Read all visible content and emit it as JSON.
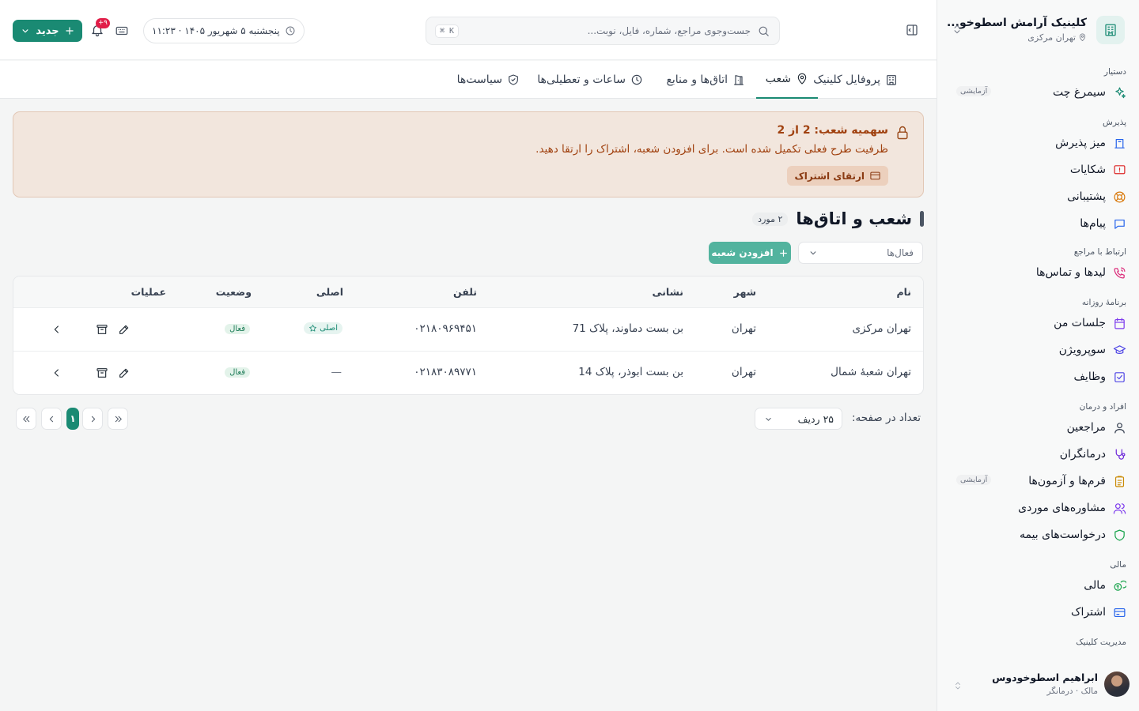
{
  "sidebar": {
    "clinic_name": "کلینیک آرامش اسطوخو...",
    "clinic_branch": "تهران مرکزی",
    "groups": [
      {
        "title": "دستیار",
        "items": [
          {
            "label": "سیمرغ چت",
            "icon": "sparkles-icon",
            "badge": "آزمایشی"
          }
        ]
      },
      {
        "title": "پذیرش",
        "items": [
          {
            "label": "میز پذیرش",
            "icon": "reception-desk-icon"
          },
          {
            "label": "شکایات",
            "icon": "complaint-icon"
          },
          {
            "label": "پشتیبانی",
            "icon": "lifebuoy-icon"
          },
          {
            "label": "پیام‌ها",
            "icon": "message-icon"
          }
        ]
      },
      {
        "title": "ارتباط با مراجع",
        "items": [
          {
            "label": "لیدها و تماس‌ها",
            "icon": "phone-call-icon"
          }
        ]
      },
      {
        "title": "برنامهٔ روزانه",
        "items": [
          {
            "label": "جلسات من",
            "icon": "calendar-icon"
          },
          {
            "label": "سوپرویژن",
            "icon": "graduation-cap-icon"
          },
          {
            "label": "وظایف",
            "icon": "checkbox-icon"
          }
        ]
      },
      {
        "title": "افراد و درمان",
        "items": [
          {
            "label": "مراجعین",
            "icon": "user-icon"
          },
          {
            "label": "درمانگران",
            "icon": "stethoscope-icon"
          },
          {
            "label": "فرم‌ها و آزمون‌ها",
            "icon": "clipboard-icon",
            "badge": "آزمایشی"
          },
          {
            "label": "مشاوره‌های موردی",
            "icon": "users-icon"
          },
          {
            "label": "درخواست‌های بیمه",
            "icon": "shield-icon"
          }
        ]
      },
      {
        "title": "مالی",
        "items": [
          {
            "label": "مالی",
            "icon": "coins-icon"
          },
          {
            "label": "اشتراک",
            "icon": "credit-card-icon"
          }
        ]
      },
      {
        "title": "مدیریت کلینیک",
        "items": []
      }
    ],
    "user": {
      "name": "ابراهیم اسطوخودوس",
      "role": "مالک · درمانگر"
    }
  },
  "header": {
    "search_placeholder": "جست‌وجوی مراجع، شماره، فایل، نوبت...",
    "search_shortcut": "⌘ K",
    "datetime": "پنجشنبه ۵ شهریور ۱۴۰۵ · ۱۱:۲۳",
    "notifications_count": "۹+",
    "new_button": "جدید"
  },
  "tabs": [
    {
      "label": "پروفایل کلینیک",
      "icon": "building-icon",
      "active": false
    },
    {
      "label": "شعب",
      "icon": "map-pin-icon",
      "active": true
    },
    {
      "label": "اتاق‌ها و منابع",
      "icon": "door-icon",
      "active": false
    },
    {
      "label": "ساعات و تعطیلی‌ها",
      "icon": "clock-icon",
      "active": false
    },
    {
      "label": "سیاست‌ها",
      "icon": "shield-check-icon",
      "active": false
    }
  ],
  "quota": {
    "title": "سهمیه شعب: 2 از 2",
    "message": "ظرفیت طرح فعلی تکمیل شده است. برای افزودن شعبه، اشتراک را ارتقا دهید.",
    "upgrade_button": "ارتقای اشتراک"
  },
  "section": {
    "title": "شعب و اتاق‌ها",
    "count": "۲ مورد",
    "filter_value": "فعال‌ها",
    "add_button": "افزودن شعبه"
  },
  "table": {
    "columns": [
      "نام",
      "شهر",
      "نشانی",
      "تلفن",
      "اصلی",
      "وضعیت",
      "عملیات"
    ],
    "rows": [
      {
        "name": "تهران مرکزی",
        "city": "تهران",
        "address": "بن بست دماوند، پلاک 71",
        "phone": "۰۲۱۸۰۹۶۹۴۵۱",
        "main": "اصلی",
        "status": "فعال"
      },
      {
        "name": "تهران شعبهٔ شمال",
        "city": "تهران",
        "address": "بن بست ابوذر، پلاک 14",
        "phone": "۰۲۱۸۳۰۸۹۷۷۱",
        "main": "—",
        "status": "فعال"
      }
    ]
  },
  "pagination": {
    "per_page_label": "تعداد در صفحه:",
    "per_page_value": "۲۵ ردیف",
    "current_page": "۱"
  },
  "colors": {
    "accent": "#1a8a73",
    "warning_bg": "#f2e6dd",
    "warning_text": "#a0410f"
  }
}
